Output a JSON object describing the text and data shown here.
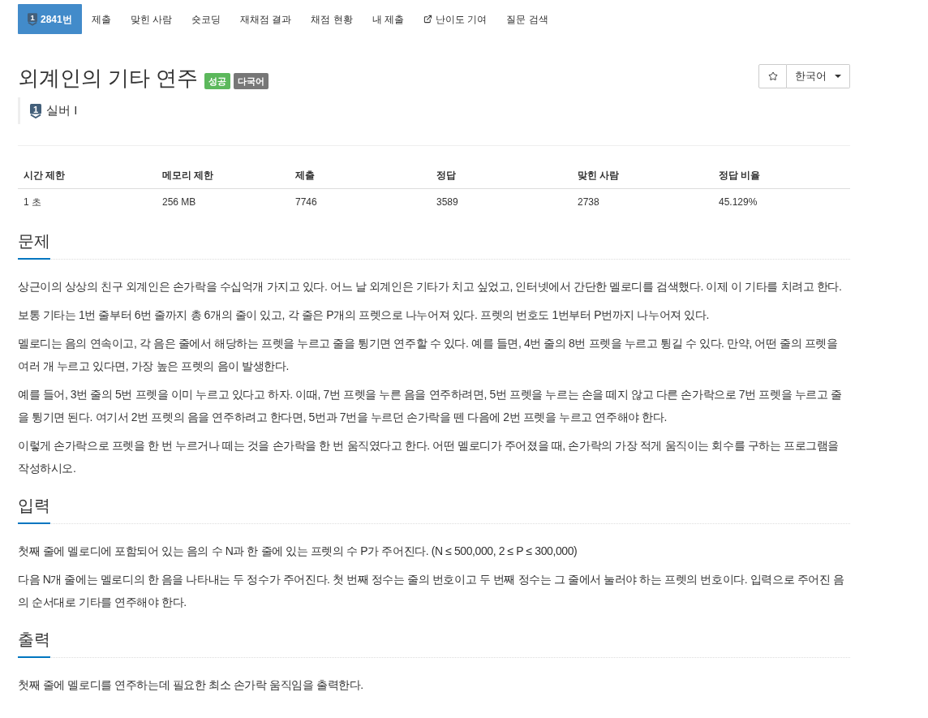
{
  "nav_tabs": [
    {
      "kind": "problem",
      "tier_number": "1",
      "label": "2841번",
      "selected": true
    },
    {
      "kind": "plain",
      "label": "제출",
      "selected": false
    },
    {
      "kind": "plain",
      "label": "맞힌 사람",
      "selected": false
    },
    {
      "kind": "plain",
      "label": "숏코딩",
      "selected": false
    },
    {
      "kind": "plain",
      "label": "재채점 결과",
      "selected": false
    },
    {
      "kind": "plain",
      "label": "채점 현황",
      "selected": false
    },
    {
      "kind": "plain",
      "label": "내 제출",
      "selected": false
    },
    {
      "kind": "external",
      "label": "난이도 기여",
      "selected": false
    },
    {
      "kind": "plain",
      "label": "질문 검색",
      "selected": false
    }
  ],
  "problem": {
    "title": "외계인의 기타 연주",
    "badges": [
      {
        "label": "성공",
        "color": "#5cb85c"
      },
      {
        "label": "다국어",
        "color": "#777777"
      }
    ],
    "tier": {
      "icon_number": "1",
      "label": "실버 I"
    }
  },
  "language_dropdown": {
    "value": "한국어"
  },
  "info_table": {
    "columns": [
      "시간 제한",
      "메모리 제한",
      "제출",
      "정답",
      "맞힌 사람",
      "정답 비율"
    ],
    "rows": [
      [
        "1 초",
        "256 MB",
        "7746",
        "3589",
        "2738",
        "45.129%"
      ]
    ]
  },
  "sections": [
    {
      "title": "문제",
      "paragraphs": [
        "상근이의 상상의 친구 외계인은 손가락을 수십억개 가지고 있다. 어느 날 외계인은 기타가 치고 싶었고, 인터넷에서 간단한 멜로디를 검색했다. 이제 이 기타를 치려고 한다.",
        "보통 기타는 1번 줄부터 6번 줄까지 총 6개의 줄이 있고, 각 줄은 P개의 프렛으로 나누어져 있다. 프렛의 번호도 1번부터 P번까지 나누어져 있다.",
        "멜로디는 음의 연속이고, 각 음은 줄에서 해당하는 프렛을 누르고 줄을 튕기면 연주할 수 있다. 예를 들면, 4번 줄의 8번 프렛을 누르고 튕길 수 있다. 만약, 어떤 줄의 프렛을 여러 개 누르고 있다면, 가장 높은 프렛의 음이 발생한다.",
        "예를 들어, 3번 줄의 5번 프렛을 이미 누르고 있다고 하자. 이때, 7번 프렛을 누른 음을 연주하려면, 5번 프렛을 누르는 손을 떼지 않고 다른 손가락으로 7번 프렛을 누르고 줄을 튕기면 된다. 여기서 2번 프렛의 음을 연주하려고 한다면, 5번과 7번을 누르던 손가락을 뗀 다음에 2번 프렛을 누르고 연주해야 한다.",
        "이렇게 손가락으로 프렛을 한 번 누르거나 떼는 것을 손가락을 한 번 움직였다고 한다. 어떤 멜로디가 주어졌을 때, 손가락의 가장 적게 움직이는 회수를 구하는 프로그램을 작성하시오."
      ]
    },
    {
      "title": "입력",
      "paragraphs": [
        "첫째 줄에 멜로디에 포함되어 있는 음의 수 N과 한 줄에 있는 프렛의 수 P가 주어진다. (N ≤ 500,000, 2 ≤ P ≤ 300,000)",
        "다음 N개 줄에는 멜로디의 한 음을 나타내는 두 정수가 주어진다. 첫 번째 정수는 줄의 번호이고 두 번째 정수는 그 줄에서 눌러야 하는 프렛의 번호이다. 입력으로 주어진 음의 순서대로 기타를 연주해야 한다."
      ]
    },
    {
      "title": "출력",
      "paragraphs": [
        "첫째 줄에 멜로디를 연주하는데 필요한 최소 손가락 움직임을 출력한다."
      ]
    }
  ]
}
